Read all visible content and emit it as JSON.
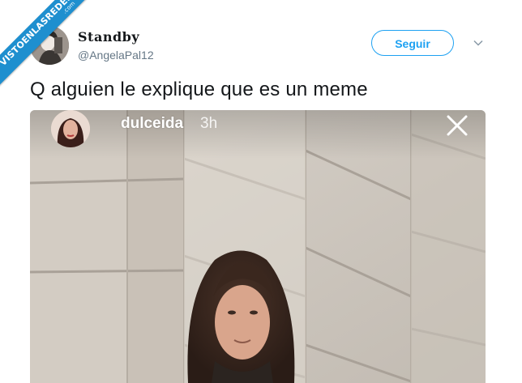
{
  "watermark": {
    "text": "VISTOENLASREDES",
    "suffix": ".com"
  },
  "tweet": {
    "display_name": "Standby",
    "handle": "@AngelaPal12",
    "follow_label": "Seguir",
    "text": "Q alguien le explique que es un meme"
  },
  "story": {
    "username": "dulceida",
    "time": "3h"
  },
  "colors": {
    "follow_blue": "#1da1f2",
    "ribbon_blue": "#1e8fcf",
    "text_dark": "#14171a",
    "handle_gray": "#657786"
  },
  "icons": [
    "chevron-down-icon",
    "close-icon"
  ]
}
